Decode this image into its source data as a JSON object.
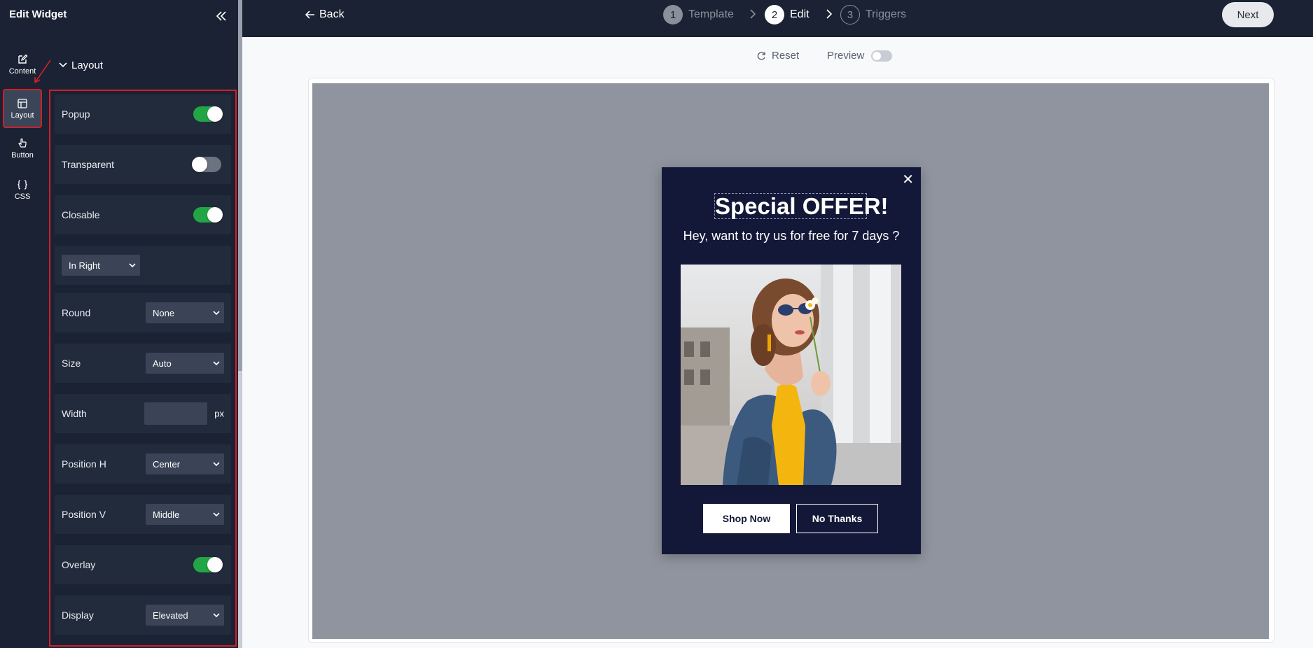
{
  "sidebar": {
    "title": "Edit Widget",
    "rail": [
      {
        "label": "Content",
        "icon": "edit-icon"
      },
      {
        "label": "Layout",
        "icon": "layout-icon",
        "active": true
      },
      {
        "label": "Button",
        "icon": "pointer-icon"
      },
      {
        "label": "CSS",
        "icon": "braces-icon"
      }
    ],
    "section_title": "Layout",
    "rows": {
      "popup": {
        "label": "Popup",
        "on": true
      },
      "transparent": {
        "label": "Transparent",
        "on": false
      },
      "closable": {
        "label": "Closable",
        "on": true
      },
      "animation": {
        "value": "In Right"
      },
      "round": {
        "label": "Round",
        "value": "None"
      },
      "size": {
        "label": "Size",
        "value": "Auto"
      },
      "width": {
        "label": "Width",
        "value": "",
        "unit": "px"
      },
      "position_h": {
        "label": "Position H",
        "value": "Center"
      },
      "position_v": {
        "label": "Position V",
        "value": "Middle"
      },
      "overlay": {
        "label": "Overlay",
        "on": true
      },
      "display": {
        "label": "Display",
        "value": "Elevated"
      }
    }
  },
  "topbar": {
    "back_label": "Back",
    "steps": [
      {
        "num": "1",
        "label": "Template",
        "state": "done"
      },
      {
        "num": "2",
        "label": "Edit",
        "state": "current"
      },
      {
        "num": "3",
        "label": "Triggers",
        "state": "todo"
      }
    ],
    "next_label": "Next"
  },
  "toolbar": {
    "reset_label": "Reset",
    "preview_label": "Preview",
    "preview_on": false
  },
  "popup": {
    "title": "Special OFFER!",
    "subtitle": "Hey, want to try us for free for 7 days ?",
    "primary_button": "Shop Now",
    "secondary_button": "No Thanks",
    "close_symbol": "✕"
  },
  "colors": {
    "sidebar_bg": "#1a2233",
    "row_bg": "#222b3c",
    "toggle_on": "#22a645",
    "highlight_red": "#d0202a",
    "popup_bg": "#141838",
    "canvas_bg": "#8f949e"
  }
}
